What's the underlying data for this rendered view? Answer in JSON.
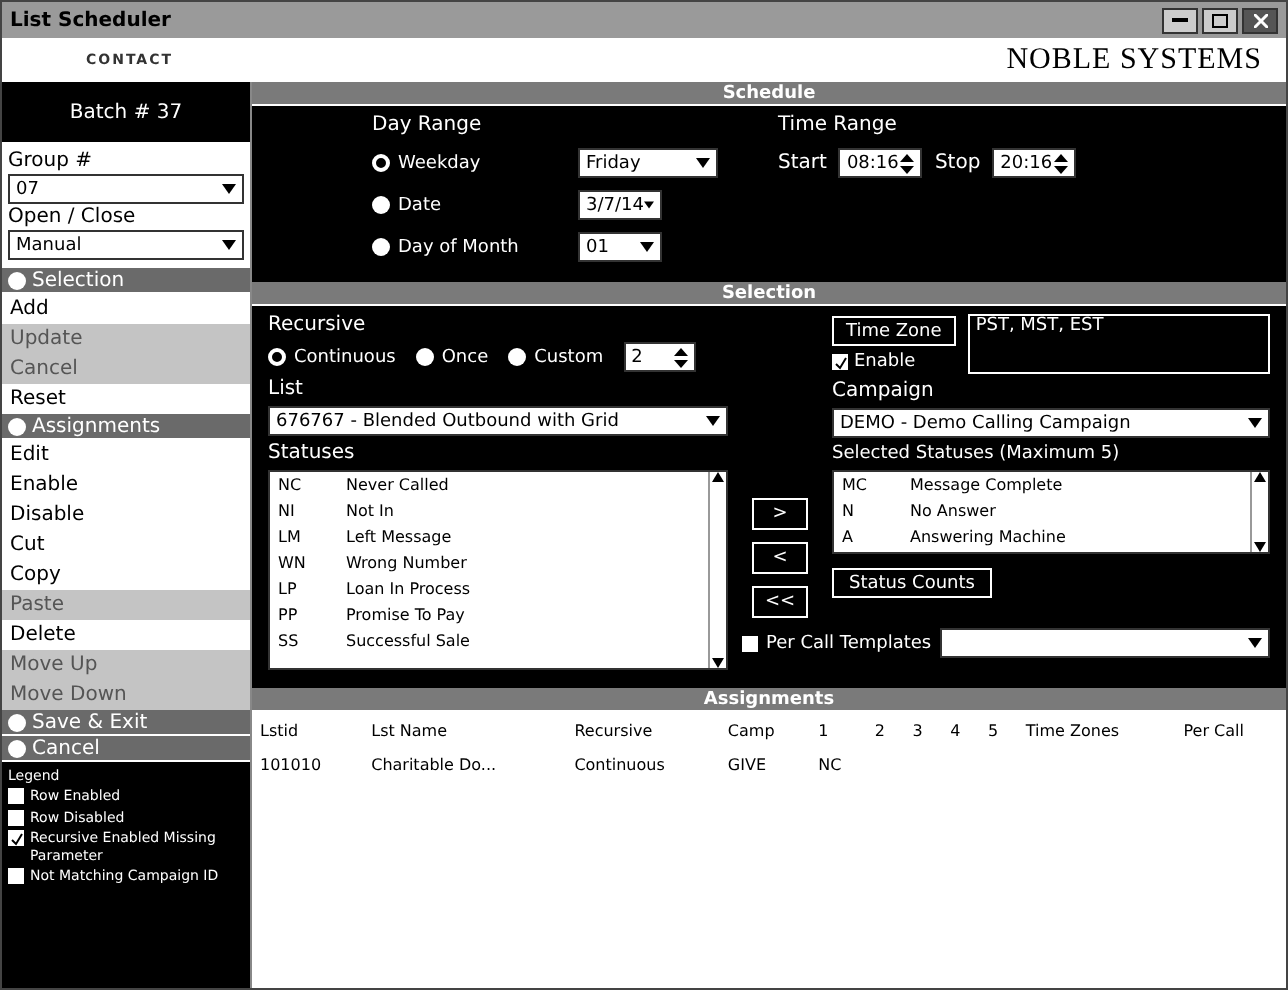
{
  "window": {
    "title": "List Scheduler"
  },
  "header": {
    "brand_left": "CONTACT",
    "brand_right": "NOBLE SYSTEMS"
  },
  "sidebar": {
    "batch": "Batch # 37",
    "group_label": "Group #",
    "group_value": "07",
    "open_close_label": "Open / Close",
    "open_close_value": "Manual",
    "sections": [
      {
        "title": "Selection",
        "items": [
          {
            "label": "Add",
            "disabled": false
          },
          {
            "label": "Update",
            "disabled": true
          },
          {
            "label": "Cancel",
            "disabled": true
          },
          {
            "label": "Reset",
            "disabled": false
          }
        ]
      },
      {
        "title": "Assignments",
        "items": [
          {
            "label": "Edit",
            "disabled": false
          },
          {
            "label": "Enable",
            "disabled": false
          },
          {
            "label": "Disable",
            "disabled": false
          },
          {
            "label": "Cut",
            "disabled": false
          },
          {
            "label": "Copy",
            "disabled": false
          },
          {
            "label": "Paste",
            "disabled": true
          },
          {
            "label": "Delete",
            "disabled": false
          },
          {
            "label": "Move Up",
            "disabled": true
          },
          {
            "label": "Move Down",
            "disabled": true
          }
        ]
      }
    ],
    "actions": [
      "Save & Exit",
      "Cancel"
    ],
    "legend": {
      "title": "Legend",
      "items": [
        {
          "label": "Row Enabled",
          "checked": false
        },
        {
          "label": "Row Disabled",
          "checked": false
        },
        {
          "label": "Recursive Enabled Missing Parameter",
          "checked": true
        },
        {
          "label": "Not Matching Campaign ID",
          "checked": false
        }
      ]
    }
  },
  "schedule": {
    "title": "Schedule",
    "day_range_label": "Day Range",
    "day_options": [
      {
        "label": "Weekday",
        "selected": true,
        "value": "Friday"
      },
      {
        "label": "Date",
        "selected": false,
        "value": "3/7/14"
      },
      {
        "label": "Day of Month",
        "selected": false,
        "value": "01"
      }
    ],
    "time_range_label": "Time Range",
    "start_label": "Start",
    "start": "08:16",
    "stop_label": "Stop",
    "stop": "20:16"
  },
  "selection": {
    "title": "Selection",
    "recursive_label": "Recursive",
    "recursive_options": [
      {
        "label": "Continuous",
        "selected": true
      },
      {
        "label": "Once",
        "selected": false
      },
      {
        "label": "Custom",
        "selected": false
      }
    ],
    "custom_count": "2",
    "list_label": "List",
    "list_value": "676767 - Blended Outbound with Grid",
    "statuses_label": "Statuses",
    "statuses": [
      [
        "NC",
        "Never Called"
      ],
      [
        "NI",
        "Not In"
      ],
      [
        "LM",
        "Left Message"
      ],
      [
        "WN",
        "Wrong Number"
      ],
      [
        "LP",
        "Loan In Process"
      ],
      [
        "PP",
        "Promise To Pay"
      ],
      [
        "SS",
        "Successful Sale"
      ]
    ],
    "move_buttons": [
      ">",
      "<",
      "<<"
    ],
    "time_zone_button": "Time Zone",
    "time_zones": "PST, MST, EST",
    "enable": {
      "label": "Enable",
      "checked": true
    },
    "campaign_label": "Campaign",
    "campaign_value": "DEMO - Demo Calling Campaign",
    "selected_statuses_label": "Selected Statuses (Maximum 5)",
    "selected_statuses": [
      [
        "MC",
        "Message Complete"
      ],
      [
        "N",
        "No Answer"
      ],
      [
        "A",
        "Answering Machine"
      ]
    ],
    "status_counts_button": "Status Counts",
    "per_call_templates": {
      "label": "Per Call Templates",
      "checked": false
    }
  },
  "assignments": {
    "title": "Assignments",
    "columns": [
      "Lstid",
      "Lst Name",
      "Recursive",
      "Camp",
      "1",
      "2",
      "3",
      "4",
      "5",
      "Time Zones",
      "Per Call"
    ],
    "rows": [
      [
        "101010",
        "Charitable Do...",
        "Continuous",
        "GIVE",
        "NC"
      ]
    ]
  }
}
